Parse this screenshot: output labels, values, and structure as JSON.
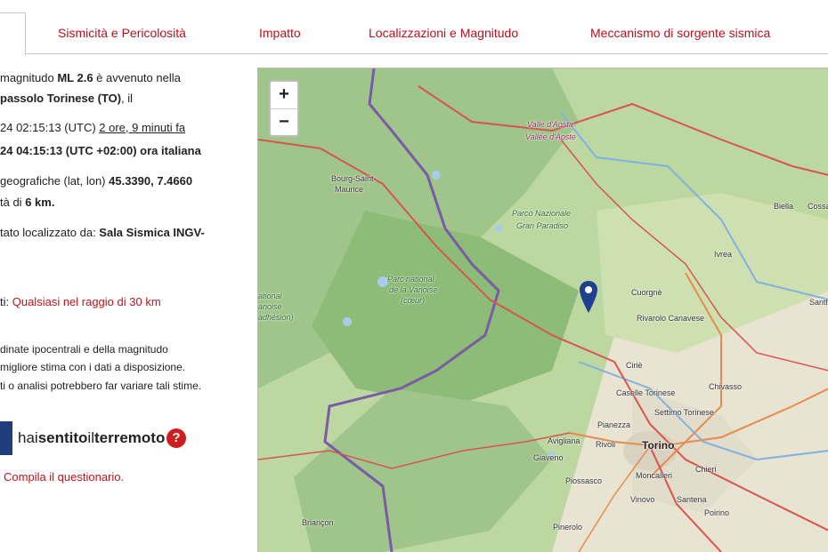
{
  "tabs": [
    "Sismicità e Pericolosità",
    "Impatto",
    "Localizzazioni e Magnitudo",
    "Meccanismo di sorgente sismica"
  ],
  "info": {
    "line1a": " magnitudo ",
    "line1b": "ML 2.6",
    "line1c": " è avvenuto nella",
    "line2a": "passolo Torinese (TO)",
    "line2b": ", il",
    "time_utc": "24 02:15:13 (UTC) ",
    "time_ago": "2 ore, 9 minuti fa",
    "time_local": "24 04:15:13 (UTC +02:00) ora italiana",
    "coords_a": "geografiche (lat, lon) ",
    "coords_b": "45.3390, 7.4660",
    "depth_a": "tà di ",
    "depth_b": "6 km.",
    "located_a": "tato localizzato da: ",
    "located_b": "Sala Sismica INGV-",
    "nearby_a": "ti: ",
    "nearby_b": "Qualsiasi nel raggio di 30 km",
    "note1": "dinate ipocentrali e della magnitudo",
    "note2": "migliore stima con i dati a disposizione.",
    "note3": "ti o analisi potrebbero far variare tali stime."
  },
  "hst": {
    "text_a": "hai",
    "text_b": "sentito",
    "text_c": "il",
    "text_d": "terremoto",
    "q": "?",
    "cta": "Compila il questionario."
  },
  "map": {
    "zoom_in": "+",
    "zoom_out": "−",
    "labels": {
      "valle": "Valle d'Aosta",
      "vallee": "Vallée d'Aoste",
      "bourg": "Bourg-Saint-",
      "maurice": "Maurice",
      "parco1": "Parco Nazionale",
      "parco2": "Gran Paradiso",
      "biella": "Biella",
      "cossato": "Cossa",
      "ivrea": "Ivrea",
      "vanoise1": "Parc national",
      "vanoise2": "de la Vanoise",
      "vanoise3": "(cœur)",
      "cuorgne": "Cuorgnè",
      "rivarolo": "Rivarolo Canavese",
      "cirie": "Ciriè",
      "caselle": "Caselle Torinese",
      "chivasso": "Chivasso",
      "settimo": "Settimo Torinese",
      "pianezza": "Pianezza",
      "avigliana": "Avigliana",
      "rivoli": "Rivoli",
      "torino": "Torino",
      "giaveno": "Giaveno",
      "piossasco": "Piossasco",
      "moncalieri": "Moncalieri",
      "chieri": "Chieri",
      "vinovo": "Vinovo",
      "santena": "Santena",
      "poirino": "Poirino",
      "pinerolo": "Pinerolo",
      "briancon": "Briançon",
      "santh": "Santh",
      "left1": "ational",
      "left2": "anoise",
      "left3": "adhésion)"
    }
  },
  "colors": {
    "accent": "#b8111f",
    "map_bg": "#bcd7a0",
    "marker": "#1f3f8f"
  }
}
